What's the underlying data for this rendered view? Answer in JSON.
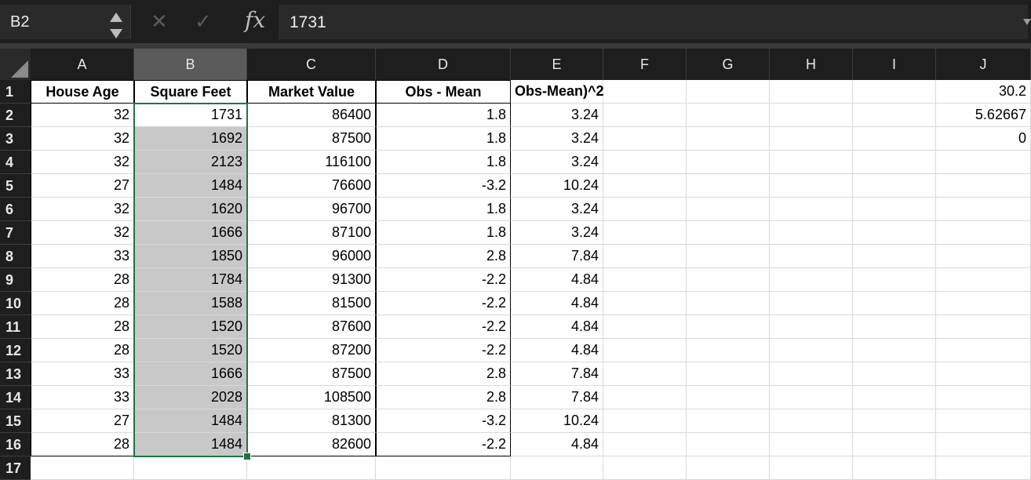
{
  "formula_bar": {
    "name_box": "B2",
    "cancel_icon": "close-icon",
    "enter_icon": "checkmark-icon",
    "fx_label": "fx",
    "formula_value": "1731"
  },
  "columns": [
    "A",
    "B",
    "C",
    "D",
    "E",
    "F",
    "G",
    "H",
    "I",
    "J"
  ],
  "selected_column": "B",
  "rows": [
    "1",
    "2",
    "3",
    "4",
    "5",
    "6",
    "7",
    "8",
    "9",
    "10",
    "11",
    "12",
    "13",
    "14",
    "15",
    "16",
    "17"
  ],
  "headers": [
    "House Age",
    "Square Feet",
    "Market Value",
    "Obs - Mean",
    "Obs-Mean)^2"
  ],
  "data": [
    [
      "32",
      "1731",
      "86400",
      "1.8",
      "3.24"
    ],
    [
      "32",
      "1692",
      "87500",
      "1.8",
      "3.24"
    ],
    [
      "32",
      "2123",
      "116100",
      "1.8",
      "3.24"
    ],
    [
      "27",
      "1484",
      "76600",
      "-3.2",
      "10.24"
    ],
    [
      "32",
      "1620",
      "96700",
      "1.8",
      "3.24"
    ],
    [
      "32",
      "1666",
      "87100",
      "1.8",
      "3.24"
    ],
    [
      "33",
      "1850",
      "96000",
      "2.8",
      "7.84"
    ],
    [
      "28",
      "1784",
      "91300",
      "-2.2",
      "4.84"
    ],
    [
      "28",
      "1588",
      "81500",
      "-2.2",
      "4.84"
    ],
    [
      "28",
      "1520",
      "87600",
      "-2.2",
      "4.84"
    ],
    [
      "28",
      "1520",
      "87200",
      "-2.2",
      "4.84"
    ],
    [
      "33",
      "1666",
      "87500",
      "2.8",
      "7.84"
    ],
    [
      "33",
      "2028",
      "108500",
      "2.8",
      "7.84"
    ],
    [
      "27",
      "1484",
      "81300",
      "-3.2",
      "10.24"
    ],
    [
      "28",
      "1484",
      "82600",
      "-2.2",
      "4.84"
    ]
  ],
  "column_j": [
    "30.2",
    "5.62667",
    "0"
  ],
  "colors": {
    "selection_border": "#217346",
    "selected_range_fill": "#c8c8c8",
    "header_bg": "#1e1e1e"
  }
}
